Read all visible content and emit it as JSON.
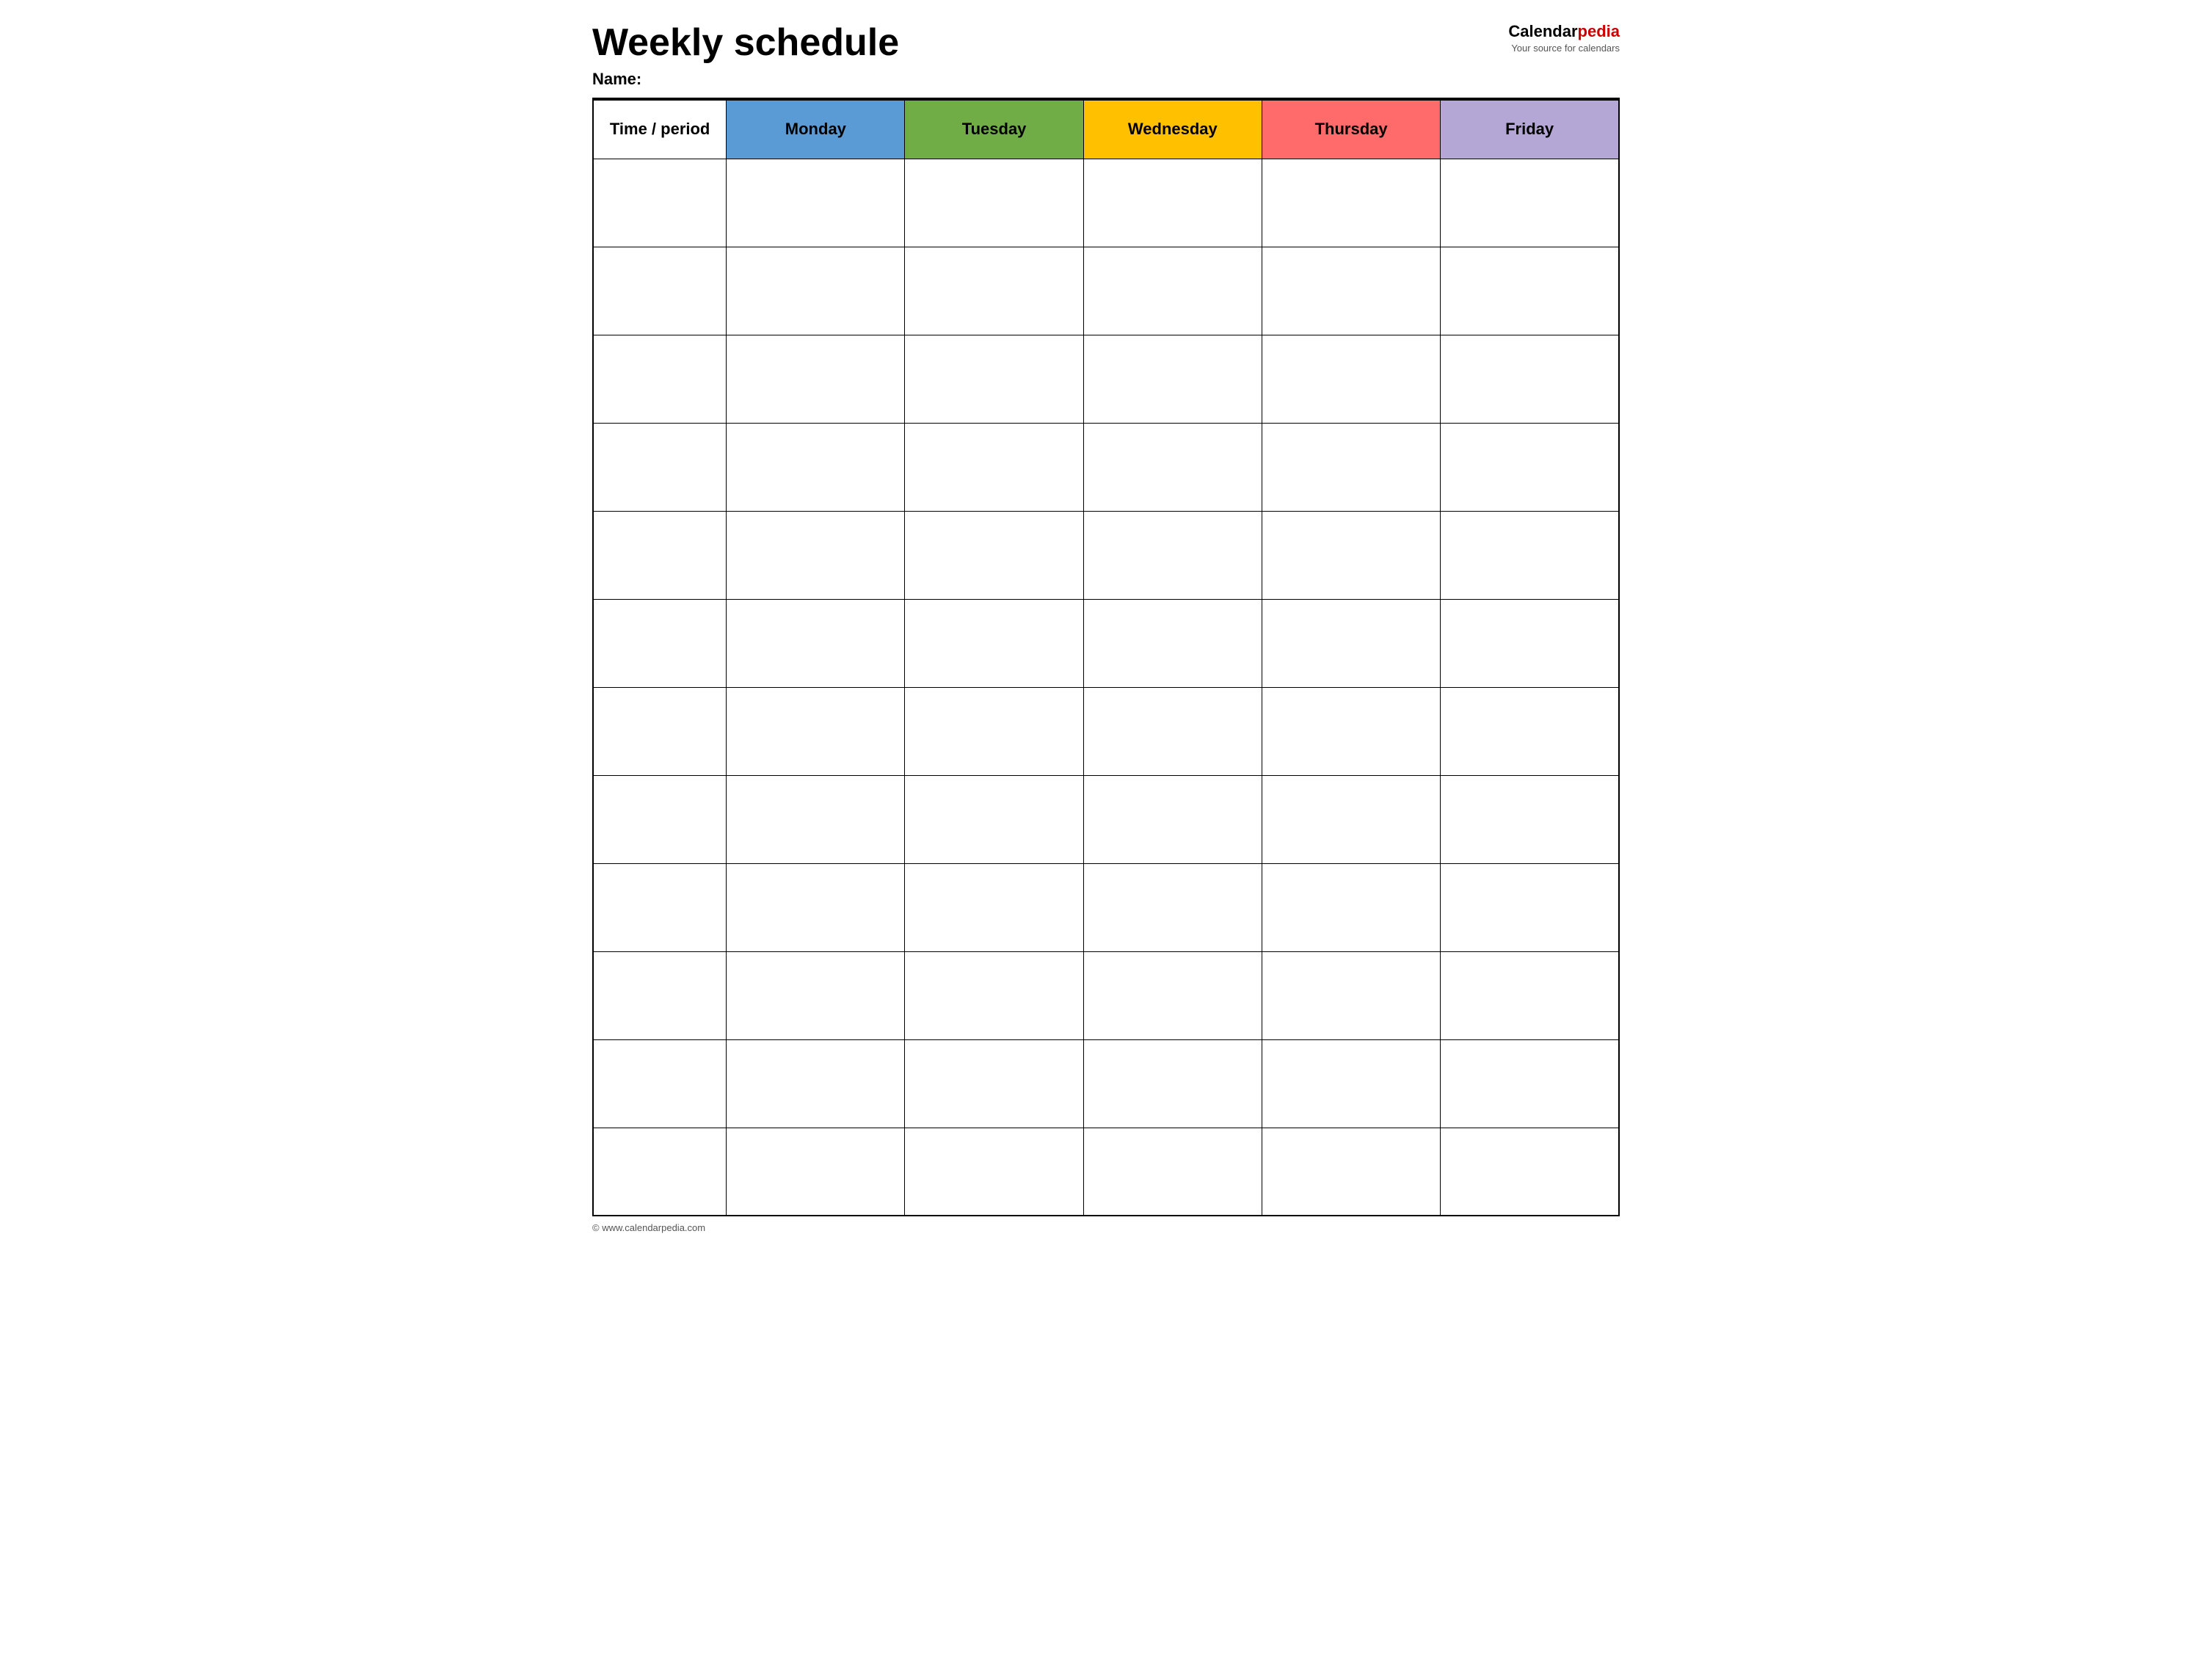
{
  "header": {
    "title": "Weekly schedule",
    "name_label": "Name:",
    "logo": {
      "calendar_text": "Calendar",
      "pedia_text": "pedia",
      "subtitle": "Your source for calendars"
    }
  },
  "table": {
    "columns": [
      {
        "id": "time",
        "label": "Time / period",
        "color": "#ffffff"
      },
      {
        "id": "monday",
        "label": "Monday",
        "color": "#5b9bd5"
      },
      {
        "id": "tuesday",
        "label": "Tuesday",
        "color": "#70ad47"
      },
      {
        "id": "wednesday",
        "label": "Wednesday",
        "color": "#ffc000"
      },
      {
        "id": "thursday",
        "label": "Thursday",
        "color": "#ff6b6b"
      },
      {
        "id": "friday",
        "label": "Friday",
        "color": "#b4a7d6"
      }
    ],
    "rows": 12
  },
  "footer": {
    "copyright": "© www.calendarpedia.com"
  }
}
